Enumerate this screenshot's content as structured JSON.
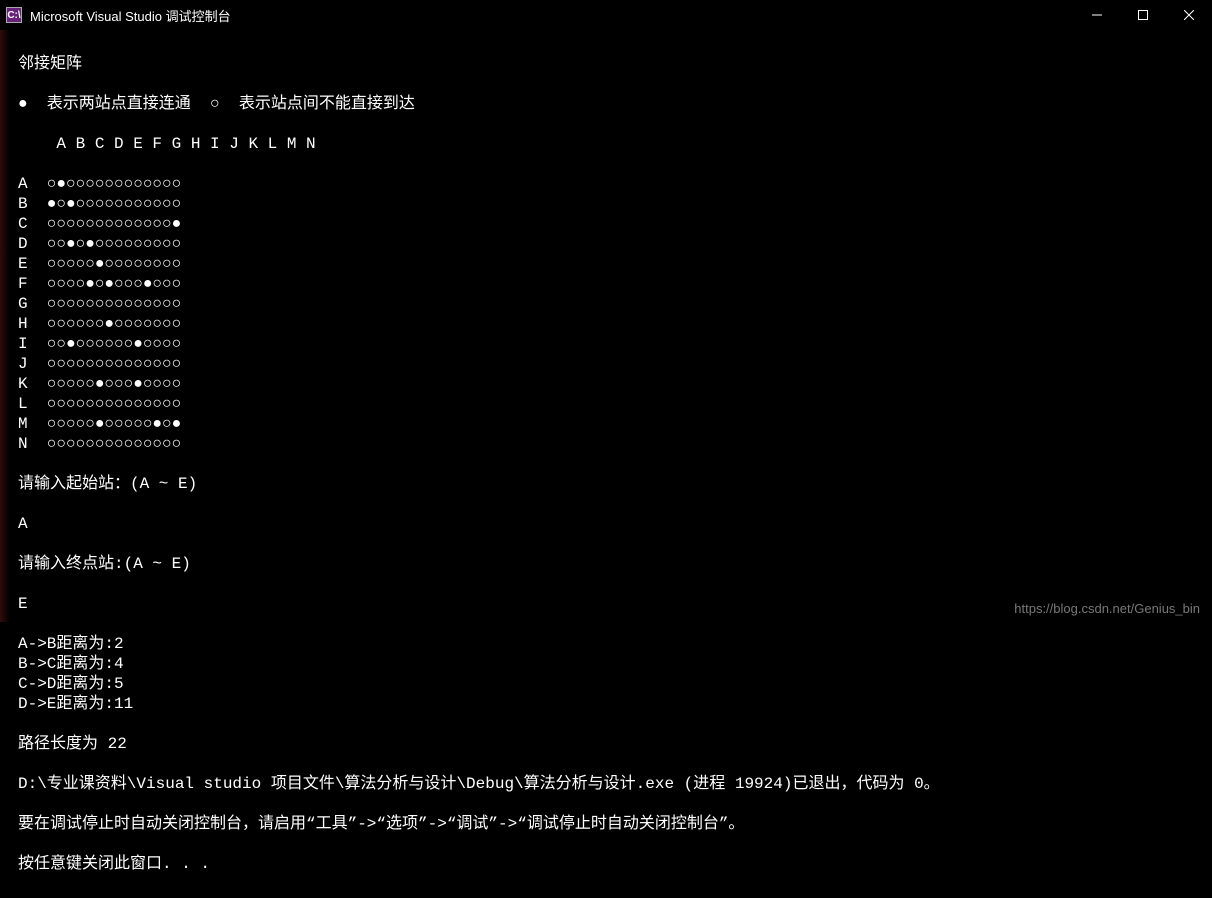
{
  "window": {
    "title": "Microsoft Visual Studio 调试控制台",
    "icon_label": "C:\\"
  },
  "console": {
    "matrix_title": "邻接矩阵",
    "legend_filled": "●  表示两站点直接连通",
    "legend_empty": "○  表示站点间不能直接到达",
    "col_header": "    A B C D E F G H I J K L M N",
    "stations": [
      "A",
      "B",
      "C",
      "D",
      "E",
      "F",
      "G",
      "H",
      "I",
      "J",
      "K",
      "L",
      "M",
      "N"
    ],
    "matrix": [
      [
        0,
        1,
        0,
        0,
        0,
        0,
        0,
        0,
        0,
        0,
        0,
        0,
        0,
        0
      ],
      [
        1,
        0,
        1,
        0,
        0,
        0,
        0,
        0,
        0,
        0,
        0,
        0,
        0,
        0
      ],
      [
        0,
        0,
        0,
        0,
        0,
        0,
        0,
        0,
        0,
        0,
        0,
        0,
        0,
        1
      ],
      [
        0,
        0,
        1,
        0,
        1,
        0,
        0,
        0,
        0,
        0,
        0,
        0,
        0,
        0
      ],
      [
        0,
        0,
        0,
        0,
        0,
        1,
        0,
        0,
        0,
        0,
        0,
        0,
        0,
        0
      ],
      [
        0,
        0,
        0,
        0,
        1,
        0,
        1,
        0,
        0,
        0,
        1,
        0,
        0,
        0
      ],
      [
        0,
        0,
        0,
        0,
        0,
        0,
        0,
        0,
        0,
        0,
        0,
        0,
        0,
        0
      ],
      [
        0,
        0,
        0,
        0,
        0,
        0,
        1,
        0,
        0,
        0,
        0,
        0,
        0,
        0
      ],
      [
        0,
        0,
        1,
        0,
        0,
        0,
        0,
        0,
        0,
        1,
        0,
        0,
        0,
        0
      ],
      [
        0,
        0,
        0,
        0,
        0,
        0,
        0,
        0,
        0,
        0,
        0,
        0,
        0,
        0
      ],
      [
        0,
        0,
        0,
        0,
        0,
        1,
        0,
        0,
        0,
        1,
        0,
        0,
        0,
        0
      ],
      [
        0,
        0,
        0,
        0,
        0,
        0,
        0,
        0,
        0,
        0,
        0,
        0,
        0,
        0
      ],
      [
        0,
        0,
        0,
        0,
        0,
        1,
        0,
        0,
        0,
        0,
        0,
        1,
        0,
        1
      ],
      [
        0,
        0,
        0,
        0,
        0,
        0,
        0,
        0,
        0,
        0,
        0,
        0,
        0,
        0
      ]
    ],
    "prompt_start": "请输入起始站：(A ~ E)",
    "input_start": "A",
    "prompt_end": "请输入终点站:(A ~ E)",
    "input_end": "E",
    "distances": [
      "A->B距离为:2",
      "B->C距离为:4",
      "C->D距离为:5",
      "D->E距离为:11"
    ],
    "path_length": "路径长度为 22",
    "exit_msg": "D:\\专业课资料\\Visual studio 项目文件\\算法分析与设计\\Debug\\算法分析与设计.exe (进程 19924)已退出，代码为 0。",
    "hint_msg": "要在调试停止时自动关闭控制台，请启用“工具”->“选项”->“调试”->“调试停止时自动关闭控制台”。",
    "close_msg": "按任意键关闭此窗口. . ."
  },
  "watermark": "https://blog.csdn.net/Genius_bin"
}
